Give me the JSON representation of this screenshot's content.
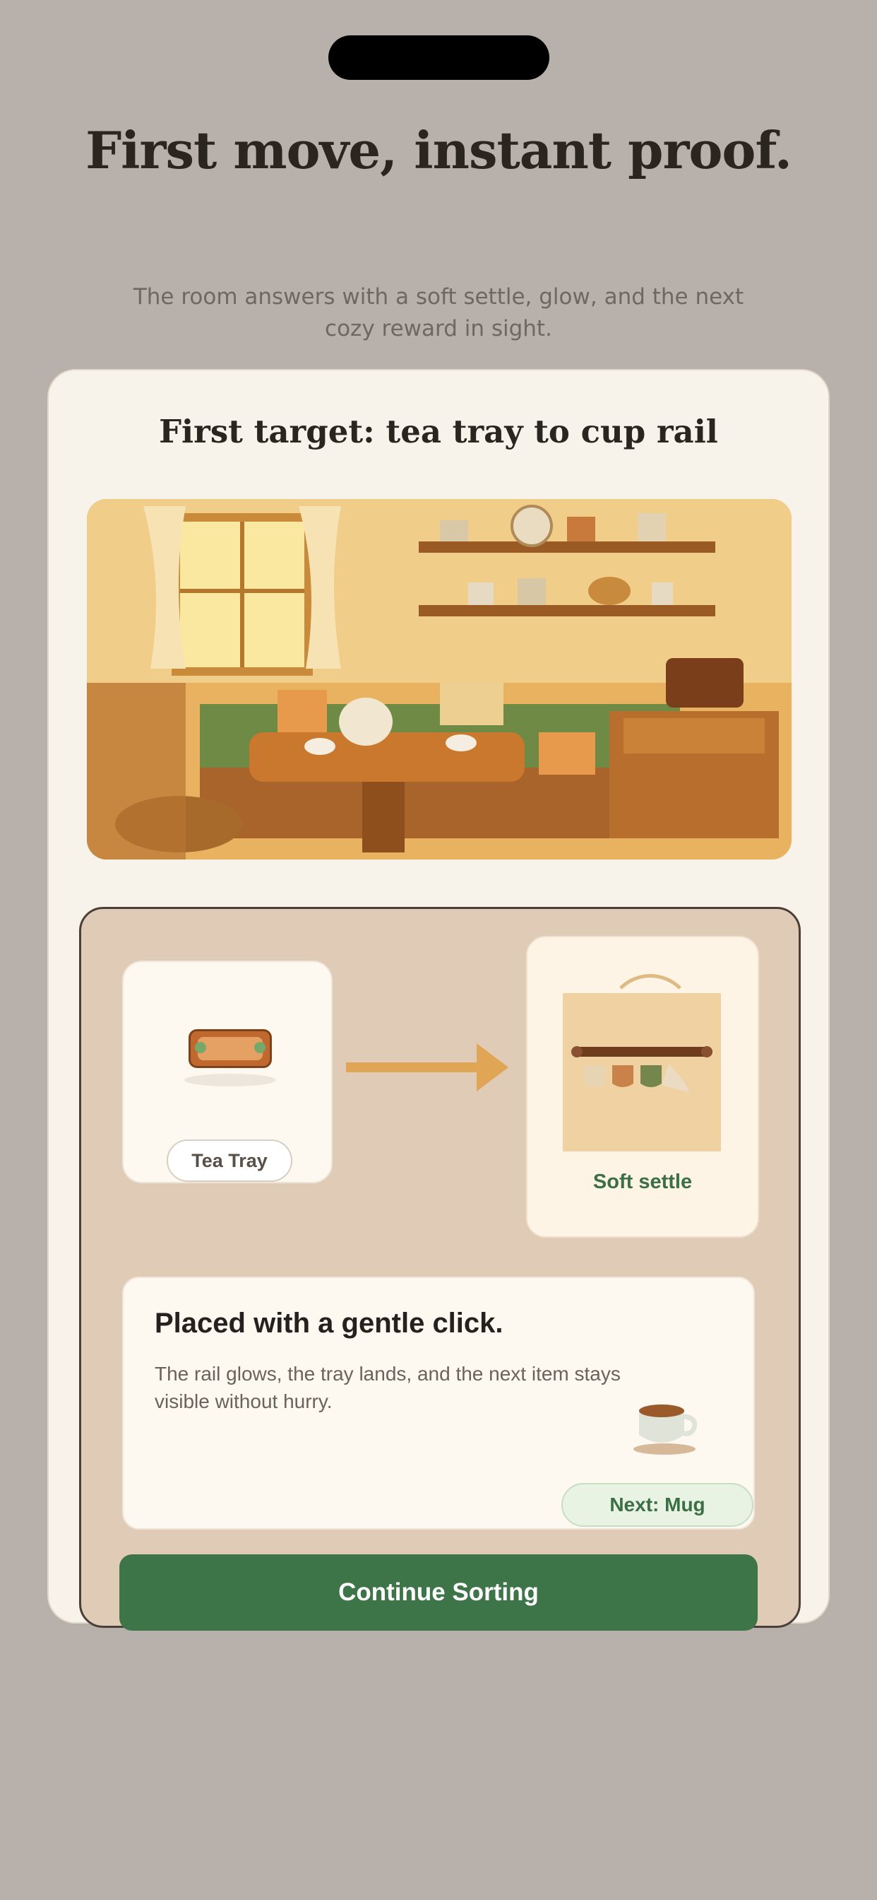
{
  "header": {
    "headline": "First move, instant proof.",
    "subhead": "The room answers with a soft settle, glow, and the next cozy reward in sight."
  },
  "card": {
    "title": "First target: tea tray to cup rail"
  },
  "move": {
    "source_label": "Tea Tray",
    "target_label": "Soft settle"
  },
  "feedback": {
    "title": "Placed with a gentle click.",
    "body": "The rail glows, the tray lands, and the next item stays visible without hurry.",
    "next_label": "Next: Mug"
  },
  "cta": {
    "label": "Continue Sorting"
  },
  "icons": {
    "source": "tea-tray-icon",
    "arrow": "arrow-right-icon",
    "target": "cup-rail-image",
    "next": "mug-icon"
  },
  "colors": {
    "background": "#b8b0aa",
    "card": "#f8f3ea",
    "panel": "#e0cbb6",
    "accent_green": "#3d7549",
    "arrow": "#e0a555",
    "tray": "#c0692f"
  }
}
